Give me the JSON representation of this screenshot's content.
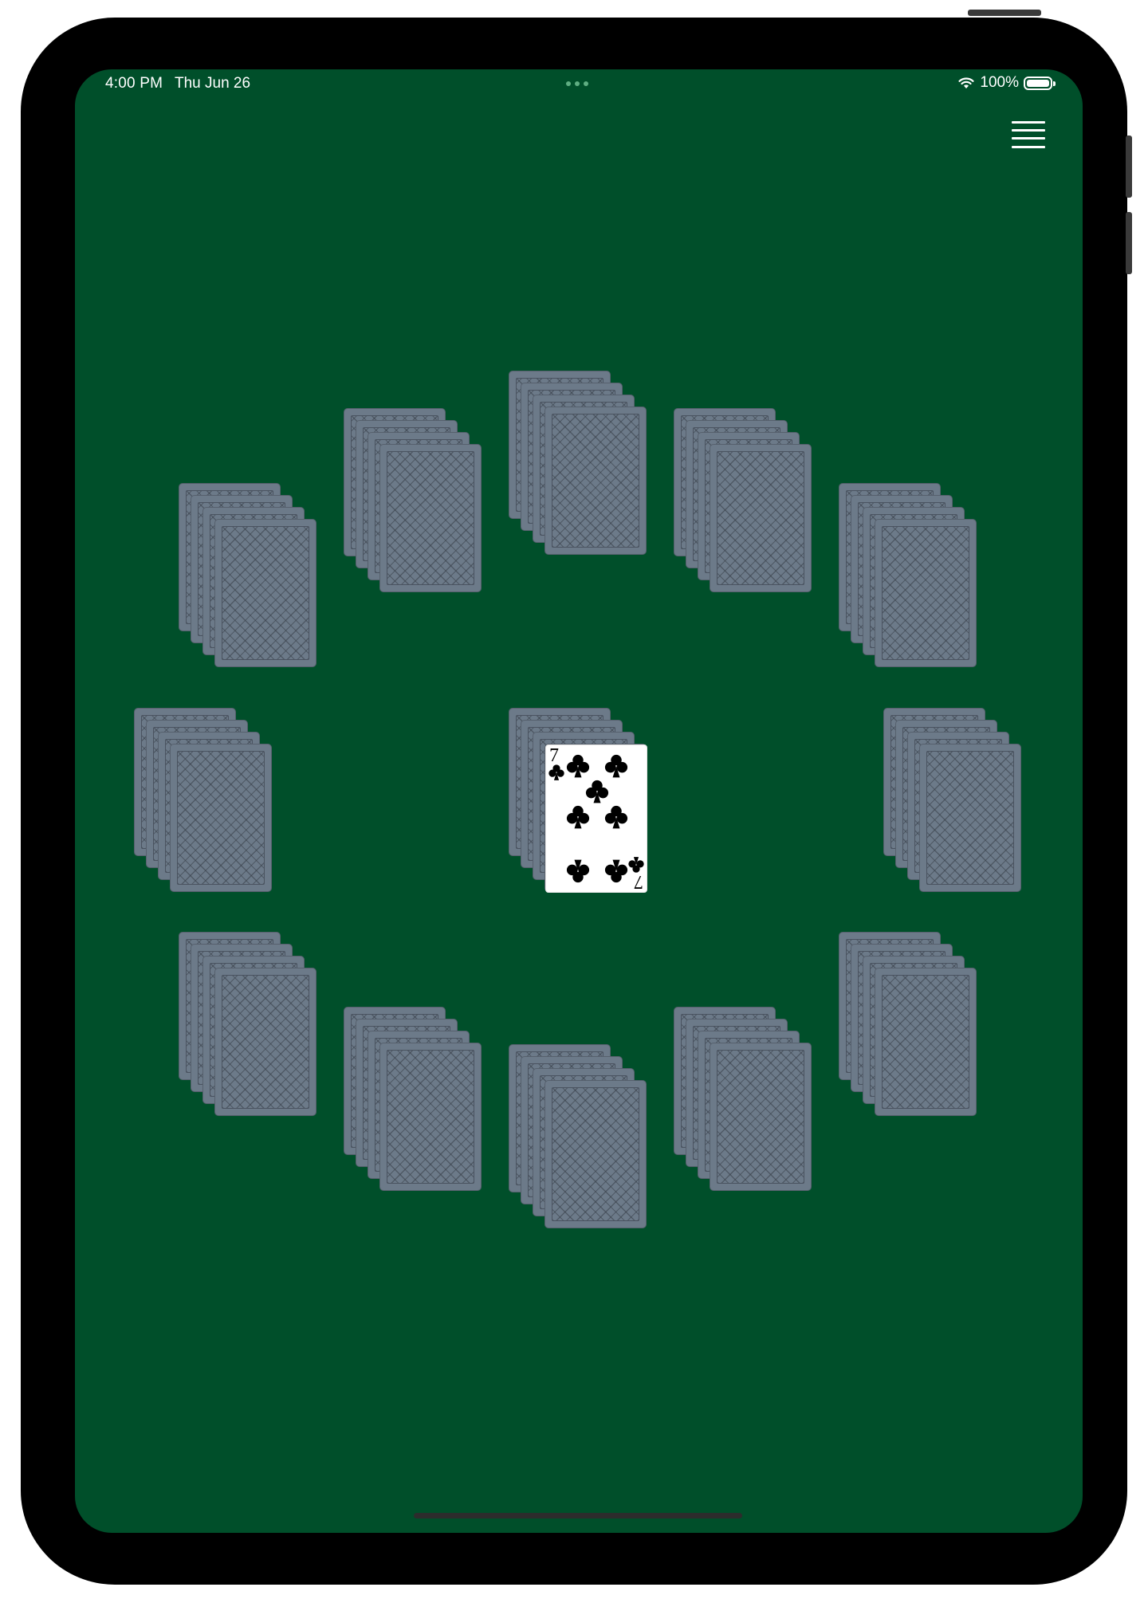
{
  "status_bar": {
    "time": "4:00 PM",
    "date": "Thu Jun 26",
    "battery": "100%"
  },
  "menu": {
    "icon": "hamburger-menu-icon"
  },
  "table": {
    "felt_color": "#004F2A",
    "card_back_color": "#6C7A89"
  },
  "piles": [
    {
      "name": "pile-top",
      "face": "down"
    },
    {
      "name": "pile-upper-right-inner",
      "face": "down"
    },
    {
      "name": "pile-upper-right-outer",
      "face": "down"
    },
    {
      "name": "pile-right",
      "face": "down"
    },
    {
      "name": "pile-lower-right-outer",
      "face": "down"
    },
    {
      "name": "pile-lower-right-inner",
      "face": "down"
    },
    {
      "name": "pile-bottom",
      "face": "down"
    },
    {
      "name": "pile-lower-left-inner",
      "face": "down"
    },
    {
      "name": "pile-lower-left-outer",
      "face": "down"
    },
    {
      "name": "pile-left",
      "face": "down"
    },
    {
      "name": "pile-upper-left-outer",
      "face": "down"
    },
    {
      "name": "pile-upper-left-inner",
      "face": "down"
    },
    {
      "name": "pile-center",
      "face": "up",
      "top_card": {
        "rank": "7",
        "suit": "clubs",
        "suit_icon": "club-icon"
      }
    }
  ]
}
